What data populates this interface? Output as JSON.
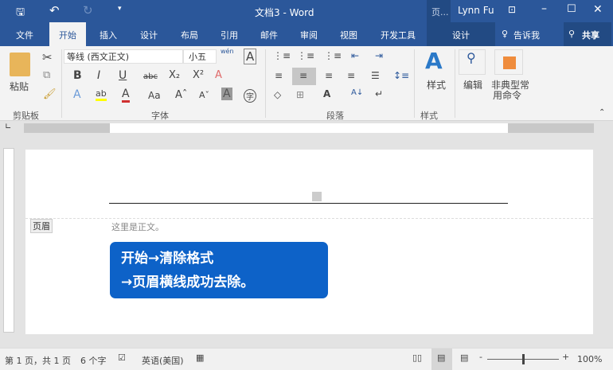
{
  "title": "文档3 - Word",
  "context_tab_group": "页...",
  "user": "Lynn Fu",
  "tabs": [
    "文件",
    "开始",
    "插入",
    "设计",
    "布局",
    "引用",
    "邮件",
    "审阅",
    "视图",
    "开发工具"
  ],
  "context_tab": "设计",
  "tell_me": "告诉我",
  "share": "共享",
  "ribbon": {
    "paste": "粘贴",
    "clipboard": "剪贴板",
    "font_name": "等线 (西文正文)",
    "font_size": "小五",
    "phonetic": "wén",
    "font_group": "字体",
    "paragraph_group": "段落",
    "styles": "样式",
    "styles_group": "样式",
    "edit": "编辑",
    "uncommon": "非典型常",
    "uncommon2": "用命令"
  },
  "document": {
    "header_tag": "页眉",
    "body_text": "这里是正文。",
    "callout_line1": "开始→清除格式",
    "callout_line2": "→页眉横线成功去除。"
  },
  "status": {
    "page": "第 1 页，共 1 页",
    "words": "6 个字",
    "language": "英语(美国)",
    "zoom": "100%",
    "zoom_percent": 100
  },
  "colors": {
    "accent": "#2b579a",
    "callout": "#0d62c8"
  }
}
